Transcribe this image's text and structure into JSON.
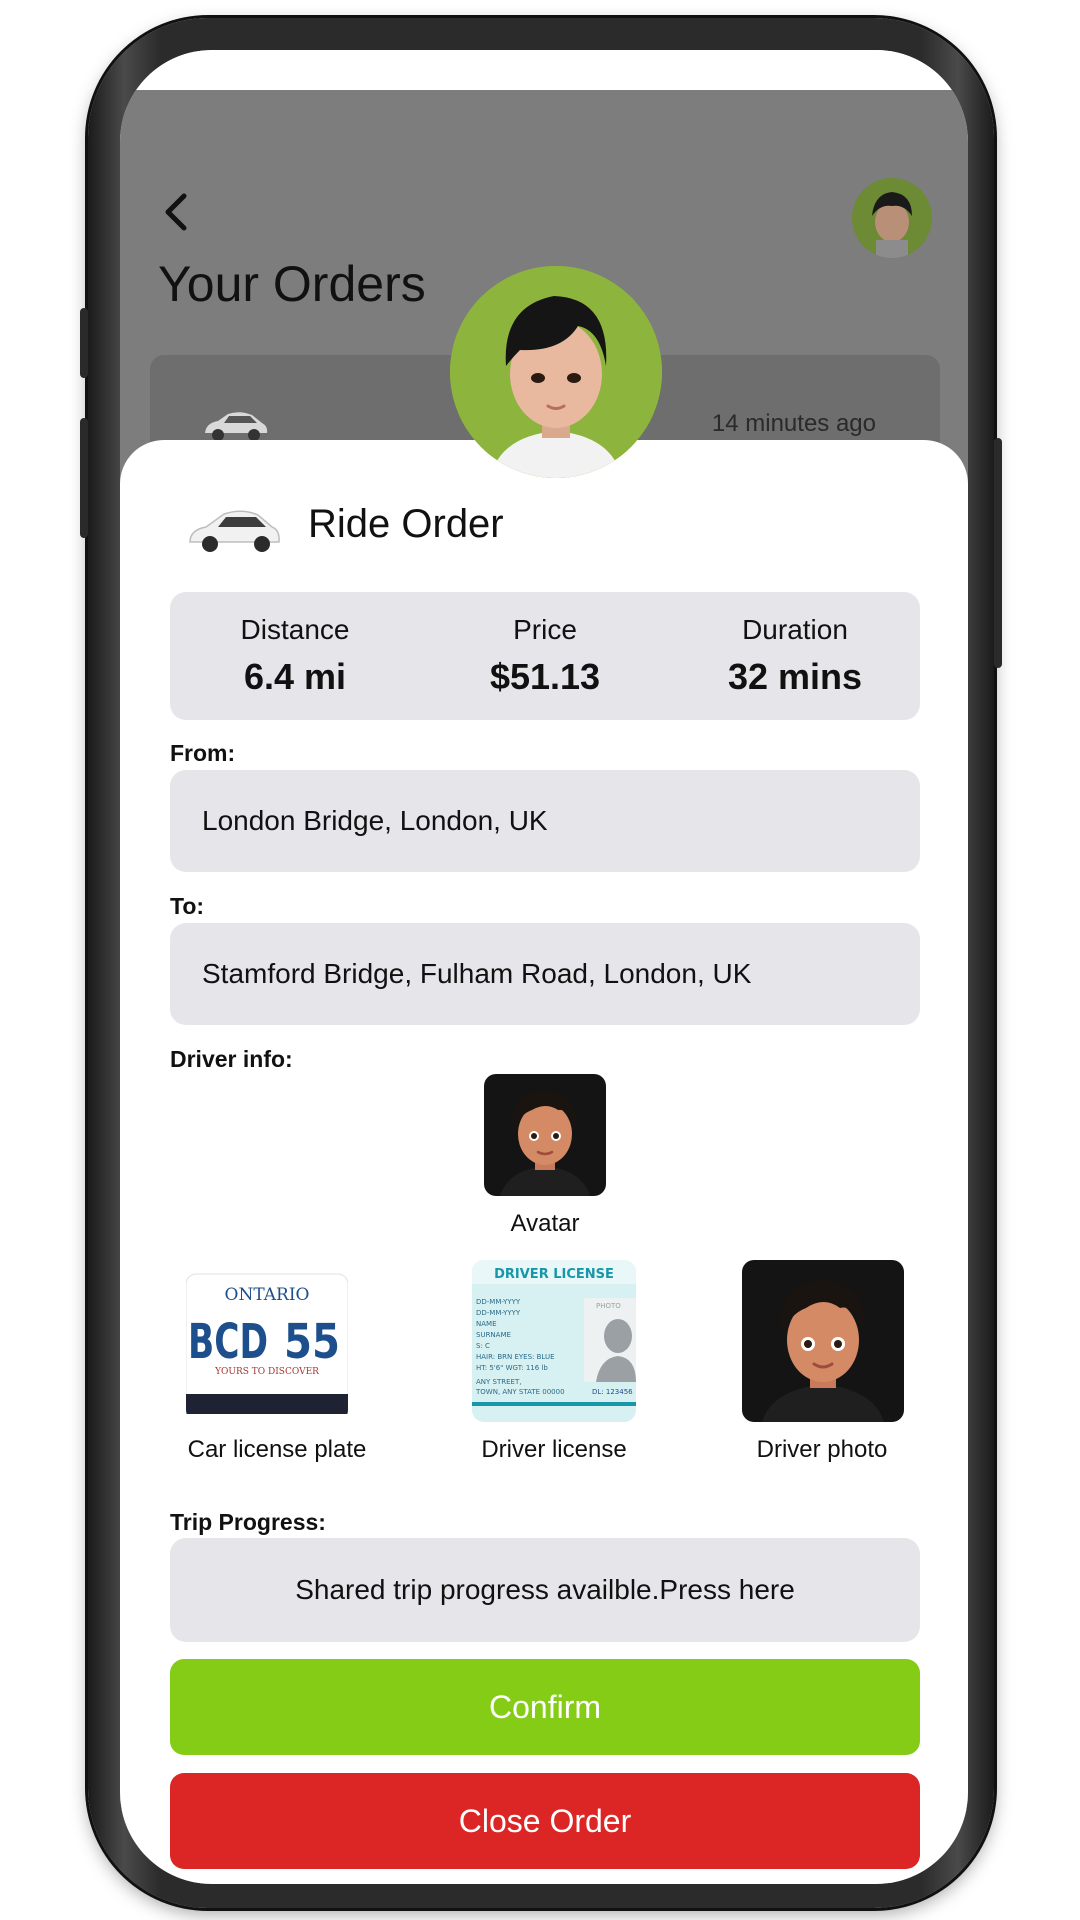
{
  "header": {
    "title": "Your Orders",
    "back_icon": "chevron-left-icon"
  },
  "background_card": {
    "time_ago": "14 minutes ago"
  },
  "order": {
    "title": "Ride Order",
    "stats": [
      {
        "label": "Distance",
        "value": "6.4 mi"
      },
      {
        "label": "Price",
        "value": "$51.13"
      },
      {
        "label": "Duration",
        "value": "32 mins"
      }
    ],
    "from_label": "From:",
    "from_value": "London Bridge, London, UK",
    "to_label": "To:",
    "to_value": "Stamford Bridge, Fulham Road, London, UK",
    "driver_info_label": "Driver info:",
    "avatar_caption": "Avatar",
    "documents": [
      {
        "caption": "Car license plate"
      },
      {
        "caption": "Driver license"
      },
      {
        "caption": "Driver photo"
      }
    ],
    "plate": {
      "region": "ONTARIO",
      "number": "BCD",
      "number2": "55",
      "tagline": "YOURS TO DISCOVER"
    },
    "license": {
      "heading": "DRIVER LICENSE",
      "lines": [
        "DD-MM-YYYY",
        "DD-MM-YYYY",
        "NAME",
        "SURNAME",
        "S: C",
        "HAIR: BRN   EYES: BLUE",
        "HT: 5'6\"   WGT: 116 lb",
        "ANY STREET,",
        "TOWN, ANY STATE 00000"
      ],
      "photo_label": "PHOTO",
      "dl": "DL: 123456"
    },
    "progress_label": "Trip Progress:",
    "progress_text": "Shared trip progress availble.Press here",
    "confirm_label": "Confirm",
    "close_label": "Close Order"
  },
  "colors": {
    "confirm": "#84cc16",
    "close": "#dc2626",
    "field_bg": "#e6e6ea",
    "overlay": "#7d7d7d"
  }
}
